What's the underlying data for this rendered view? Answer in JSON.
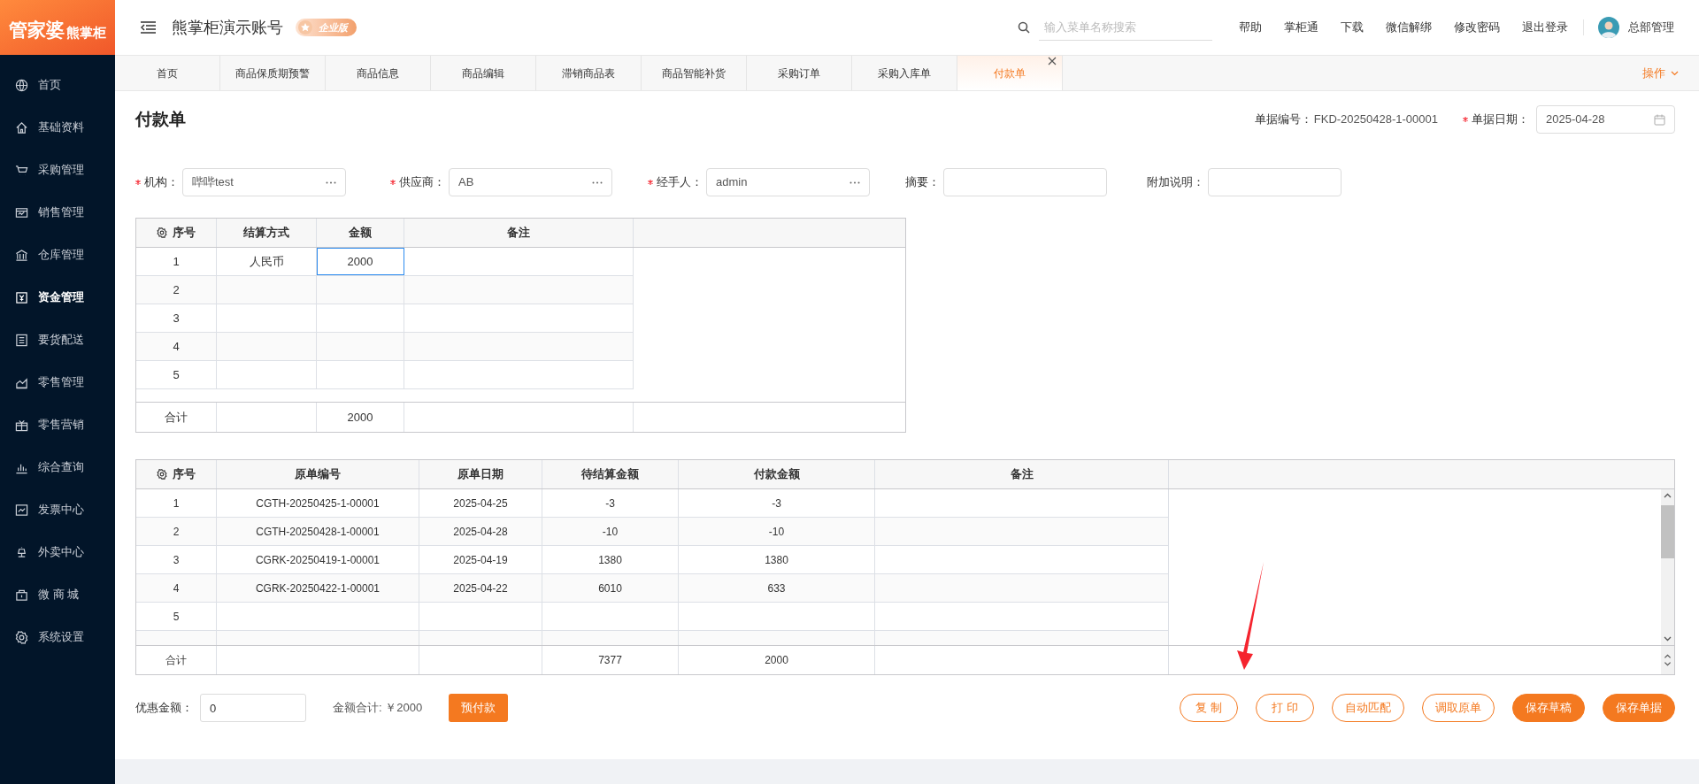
{
  "logo": {
    "main": "管家婆",
    "sub": "熊掌柜"
  },
  "header": {
    "account": "熊掌柜演示账号",
    "edition": "企业版",
    "search": {
      "placeholder": "输入菜单名称搜索"
    },
    "links": [
      "帮助",
      "掌柜通",
      "下载",
      "微信解绑",
      "修改密码",
      "退出登录"
    ],
    "user": "总部管理"
  },
  "sidebar": {
    "items": [
      {
        "label": "首页",
        "selected": false
      },
      {
        "label": "基础资料",
        "selected": false
      },
      {
        "label": "采购管理",
        "selected": false
      },
      {
        "label": "销售管理",
        "selected": false
      },
      {
        "label": "仓库管理",
        "selected": false
      },
      {
        "label": "资金管理",
        "selected": true
      },
      {
        "label": "要货配送",
        "selected": false
      },
      {
        "label": "零售管理",
        "selected": false
      },
      {
        "label": "零售营销",
        "selected": false
      },
      {
        "label": "综合查询",
        "selected": false
      },
      {
        "label": "发票中心",
        "selected": false
      },
      {
        "label": "外卖中心",
        "selected": false
      },
      {
        "label": "微 商 城",
        "selected": false
      },
      {
        "label": "系统设置",
        "selected": false
      }
    ]
  },
  "tabs": [
    {
      "label": "首页",
      "selected": false
    },
    {
      "label": "商品保质期预警",
      "selected": false
    },
    {
      "label": "商品信息",
      "selected": false
    },
    {
      "label": "商品编辑",
      "selected": false
    },
    {
      "label": "滞销商品表",
      "selected": false
    },
    {
      "label": "商品智能补货",
      "selected": false
    },
    {
      "label": "采购订单",
      "selected": false
    },
    {
      "label": "采购入库单",
      "selected": false
    },
    {
      "label": "付款单",
      "selected": true
    }
  ],
  "tab_menu": "操作",
  "form": {
    "title": "付款单",
    "doc_no_label": "单据编号：",
    "doc_no": "FKD-20250428-1-00001",
    "date_label": "单据日期：",
    "date_required": true,
    "date": "2025-04-28",
    "fields": [
      {
        "label": "机构：",
        "required": true,
        "value": "哔哔test",
        "picker": true
      },
      {
        "label": "供应商：",
        "required": true,
        "value": "AB",
        "picker": true
      },
      {
        "label": "经手人：",
        "required": true,
        "value": "admin",
        "picker": true
      },
      {
        "label": "摘要：",
        "required": false,
        "picker": false
      },
      {
        "label": "附加说明：",
        "required": false,
        "picker": false
      }
    ]
  },
  "payment_table": {
    "columns": [
      "序号",
      "结算方式",
      "金额",
      "备注"
    ],
    "rows": [
      {
        "no": "1",
        "method": "人民币",
        "amount": "2000",
        "focused": true
      },
      {
        "no": "2",
        "focused": false
      },
      {
        "no": "3",
        "focused": false
      },
      {
        "no": "4",
        "focused": false
      },
      {
        "no": "5",
        "focused": false
      }
    ],
    "total": {
      "label": "合计",
      "amount": "2000"
    }
  },
  "source_table": {
    "columns": [
      "序号",
      "原单编号",
      "原单日期",
      "待结算金额",
      "付款金额",
      "备注"
    ],
    "rows": [
      {
        "no": "1",
        "order_no": "CGTH-20250425-1-00001",
        "order_date": "2025-04-25",
        "pending": "-3",
        "paid": "-3"
      },
      {
        "no": "2",
        "order_no": "CGTH-20250428-1-00001",
        "order_date": "2025-04-28",
        "pending": "-10",
        "paid": "-10"
      },
      {
        "no": "3",
        "order_no": "CGRK-20250419-1-00001",
        "order_date": "2025-04-19",
        "pending": "1380",
        "paid": "1380"
      },
      {
        "no": "4",
        "order_no": "CGRK-20250422-1-00001",
        "order_date": "2025-04-22",
        "pending": "6010",
        "paid": "633"
      },
      {
        "no": "5"
      }
    ],
    "total": {
      "label": "合计",
      "pending": "7377",
      "paid": "2000"
    }
  },
  "footer": {
    "discount_label": "优惠金额：",
    "discount": "0",
    "sum": "金额合计: ￥2000",
    "prepay": "预付款",
    "buttons": [
      {
        "label": "复 制",
        "kind": "outline"
      },
      {
        "label": "打 印",
        "kind": "outline"
      },
      {
        "label": "自动匹配",
        "kind": "outline"
      },
      {
        "label": "调取原单",
        "kind": "outline"
      },
      {
        "label": "保存草稿",
        "kind": "filled"
      },
      {
        "label": "保存单据",
        "kind": "filled"
      }
    ]
  }
}
